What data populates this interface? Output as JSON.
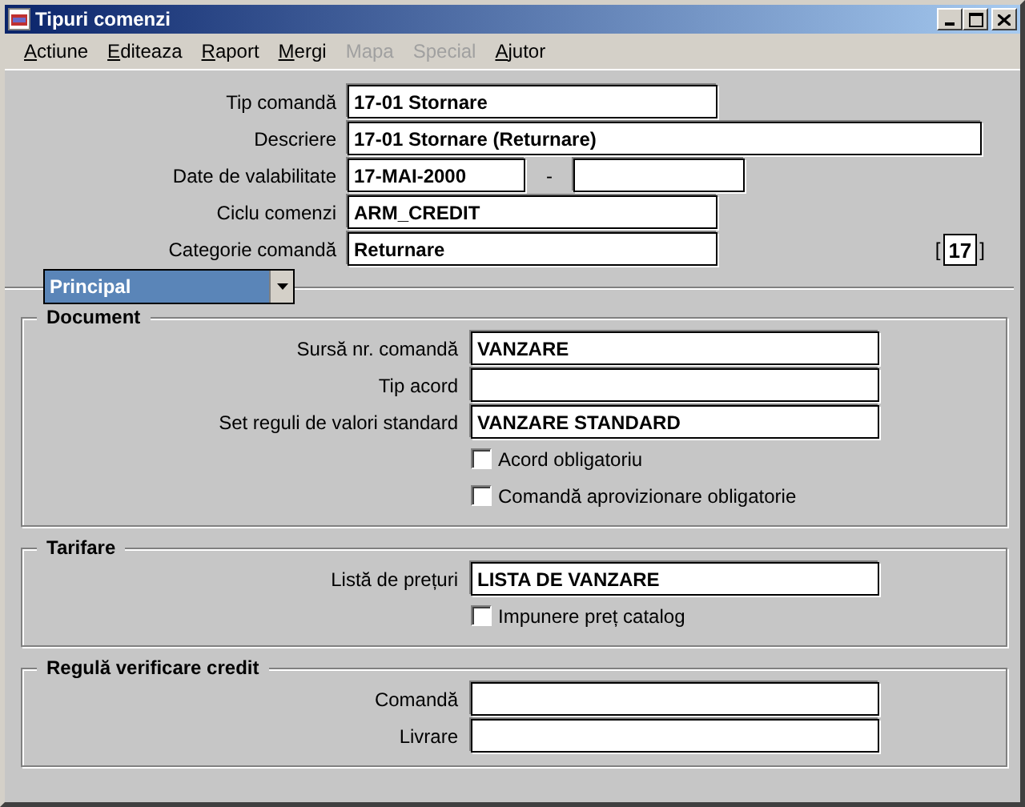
{
  "window": {
    "title": "Tipuri comenzi"
  },
  "menu": [
    {
      "label": "Actiune",
      "disabled": false
    },
    {
      "label": "Editeaza",
      "disabled": false
    },
    {
      "label": "Raport",
      "disabled": false
    },
    {
      "label": "Mergi",
      "disabled": false
    },
    {
      "label": "Mapa",
      "disabled": true
    },
    {
      "label": "Special",
      "disabled": true
    },
    {
      "label": "Ajutor",
      "disabled": false
    }
  ],
  "header_fields": [
    {
      "kind": "short",
      "label": "Tip comandă",
      "value": "17-01 Stornare"
    },
    {
      "kind": "long",
      "label": "Descriere",
      "value": "17-01 Stornare (Returnare)"
    },
    {
      "kind": "range",
      "label": "Date de valabilitate",
      "value": "17-MAI-2000",
      "separator": "-"
    },
    {
      "kind": "short",
      "label": "Ciclu comenzi",
      "value": "ARM_CREDIT"
    },
    {
      "kind": "short",
      "label": "Categorie comandă",
      "value": "Returnare"
    }
  ],
  "record_indicator": {
    "open": "[",
    "value": "17",
    "close": "]"
  },
  "tab_dropdown": {
    "value": "Principal"
  },
  "groups": [
    {
      "title": "Document",
      "fields": [
        {
          "kind": "text",
          "label": "Sursă nr. comandă",
          "value": "VANZARE"
        },
        {
          "kind": "text",
          "label": "Tip acord"
        },
        {
          "kind": "text",
          "label": "Set reguli de valori standard",
          "value": "VANZARE STANDARD"
        },
        {
          "kind": "checkbox",
          "label": "Acord obligatoriu",
          "checked": false
        },
        {
          "kind": "checkbox",
          "label": "Comandă aprovizionare obligatorie",
          "checked": false
        }
      ]
    },
    {
      "title": "Tarifare",
      "fields": [
        {
          "kind": "text",
          "label": "Listă de prețuri",
          "value": "LISTA DE VANZARE"
        },
        {
          "kind": "checkbox",
          "label": "Impunere preț catalog",
          "checked": false
        }
      ]
    },
    {
      "title": "Regulă verificare credit",
      "fields": [
        {
          "kind": "text",
          "label": "Comandă"
        },
        {
          "kind": "text",
          "label": "Livrare"
        }
      ]
    }
  ]
}
